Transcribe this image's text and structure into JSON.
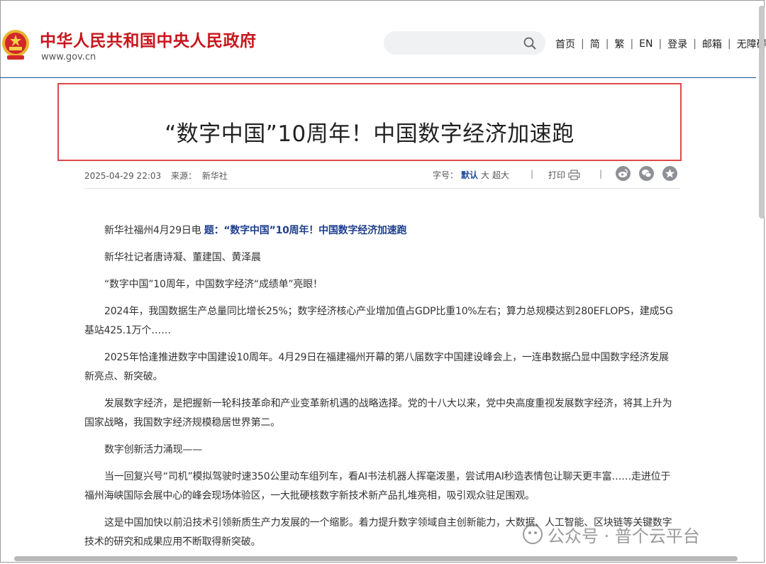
{
  "header": {
    "site_name": "中华人民共和国中央人民政府",
    "site_url": "www.gov.cn",
    "search_placeholder": "",
    "nav": [
      "首页",
      "简",
      "繁",
      "EN",
      "登录",
      "邮箱",
      "无障碍"
    ]
  },
  "article": {
    "title": "“数字中国”10周年！中国数字经济加速跑",
    "date": "2025-04-29 22:03",
    "source_label": "来源：",
    "source": "新华社",
    "font_size_label": "字号：",
    "font_sizes": [
      "默认",
      "大",
      "超大"
    ],
    "print_label": "打印",
    "dateline": "新华社福州4月29日电",
    "lead_title": "题：“数字中国”10周年！中国数字经济加速跑",
    "paragraphs": [
      "新华社记者唐诗凝、董建国、黄泽晨",
      "“数字中国”10周年，中国数字经济“成绩单”亮眼！",
      "2024年，我国数据生产总量同比增长25%；数字经济核心产业增加值占GDP比重10%左右；算力总规模达到280EFLOPS，建成5G基站425.1万个……",
      "2025年恰逢推进数字中国建设10周年。4月29日在福建福州开幕的第八届数字中国建设峰会上，一连串数据凸显中国数字经济发展新亮点、新突破。",
      "发展数字经济，是把握新一轮科技革命和产业变革新机遇的战略选择。党的十八大以来，党中央高度重视发展数字经济，将其上升为国家战略，我国数字经济规模稳居世界第二。",
      "数字创新活力涌现——",
      "当一回复兴号“司机”模拟驾驶时速350公里动车组列车，看AI书法机器人挥毫泼墨，尝试用AI秒造表情包让聊天更丰富……走进位于福州海峡国际会展中心的峰会现场体验区，一大批硬核数字新技术新产品扎堆亮相，吸引观众驻足围观。",
      "这是中国加快以前沿技术引领新质生产力发展的一个缩影。着力提升数字领域自主创新能力，大数据、人工智能、区块链等关键数字技术的研究和成果应用不断取得新突破。"
    ]
  },
  "watermark": "公众号 · 普个云平台",
  "colors": {
    "brand_red": "#c8161d",
    "link_blue": "#1f4e9c",
    "highlight_border": "#e0484a"
  }
}
